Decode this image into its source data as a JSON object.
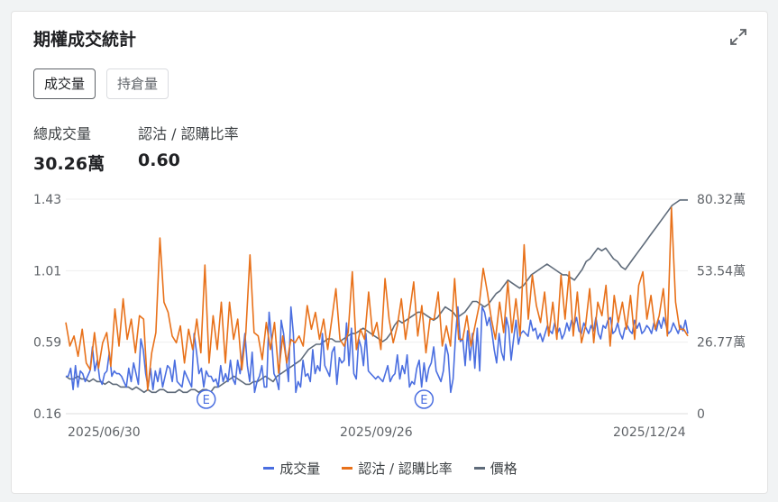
{
  "card": {
    "title": "期權成交統計",
    "tabs": [
      {
        "label": "成交量",
        "active": true
      },
      {
        "label": "持倉量",
        "active": false
      }
    ],
    "stats": [
      {
        "label": "總成交量",
        "value": "30.26萬"
      },
      {
        "label": "認沽 / 認購比率",
        "value": "0.60"
      }
    ],
    "expand_icon": "expand-icon"
  },
  "chart_data": {
    "type": "line",
    "x_tick_labels": [
      "2025/06/30",
      "2025/09/26",
      "2025/12/24"
    ],
    "left_axis": {
      "ticks": [
        "1.43",
        "1.01",
        "0.59",
        "0.16"
      ],
      "range": [
        0.16,
        1.43
      ]
    },
    "right_axis": {
      "ticks": [
        "80.32萬",
        "53.54萬",
        "26.77萬",
        "0"
      ],
      "range": [
        0,
        80.32
      ]
    },
    "markers": [
      {
        "label": "E",
        "x_index": 58
      },
      {
        "label": "E",
        "x_index": 148
      }
    ],
    "series": [
      {
        "name": "成交量",
        "axis": "right",
        "color": "#4a6ee0",
        "values": [
          14,
          14,
          17,
          9,
          18,
          10,
          16,
          15,
          12,
          14,
          16,
          25,
          16,
          20,
          13,
          11,
          15,
          16,
          23,
          14,
          16,
          15,
          15,
          14,
          12,
          10,
          17,
          12,
          19,
          15,
          11,
          28,
          24,
          15,
          10,
          17,
          9,
          16,
          12,
          17,
          10,
          14,
          18,
          17,
          12,
          20,
          12,
          11,
          10,
          16,
          14,
          12,
          10,
          30,
          23,
          15,
          17,
          10,
          16,
          14,
          14,
          12,
          13,
          10,
          18,
          12,
          15,
          12,
          20,
          13,
          11,
          20,
          15,
          22,
          30,
          18,
          12,
          23,
          8,
          12,
          14,
          18,
          10,
          10,
          38,
          28,
          15,
          13,
          9,
          35,
          30,
          21,
          12,
          40,
          30,
          8,
          12,
          10,
          20,
          14,
          15,
          12,
          24,
          15,
          18,
          16,
          30,
          18,
          16,
          14,
          23,
          25,
          11,
          21,
          19,
          20,
          34,
          18,
          32,
          15,
          13,
          28,
          25,
          18,
          30,
          16,
          15,
          14,
          13,
          14,
          13,
          12,
          15,
          18,
          12,
          14,
          15,
          22,
          13,
          18,
          15,
          22,
          10,
          12,
          11,
          17,
          20,
          10,
          19,
          12,
          17,
          19,
          25,
          16,
          14,
          12,
          16,
          26,
          22,
          8,
          13,
          29,
          40,
          27,
          28,
          18,
          31,
          20,
          30,
          17,
          32,
          16,
          40,
          38,
          33,
          36,
          31,
          24,
          19,
          30,
          23,
          20,
          36,
          32,
          20,
          28,
          35,
          26,
          30,
          31,
          30,
          29,
          35,
          31,
          32,
          28,
          30,
          27,
          30,
          33,
          31,
          30,
          34,
          30,
          32,
          28,
          30,
          34,
          31,
          35,
          33,
          36,
          31,
          30,
          34,
          32,
          30,
          33,
          31,
          36,
          30,
          28,
          33,
          32,
          35,
          36,
          30,
          31,
          34,
          30,
          28,
          32,
          33,
          31,
          30,
          35,
          32,
          34,
          30,
          31,
          33,
          32,
          30,
          34,
          31,
          35,
          32,
          36,
          33,
          30,
          31,
          34,
          32,
          30,
          33,
          31,
          35,
          30
        ]
      },
      {
        "name": "認沽 / 認購比率",
        "axis": "left",
        "color": "#e8711a",
        "values": [
          0.7,
          0.56,
          0.62,
          0.5,
          0.66,
          0.46,
          0.42,
          0.64,
          0.43,
          0.58,
          0.64,
          0.44,
          0.78,
          0.56,
          0.84,
          0.6,
          0.72,
          0.52,
          0.74,
          0.72,
          0.3,
          0.52,
          0.64,
          1.2,
          0.82,
          0.76,
          0.62,
          0.58,
          0.68,
          0.46,
          0.66,
          0.54,
          0.72,
          0.52,
          1.04,
          0.46,
          0.74,
          0.54,
          0.82,
          0.46,
          0.82,
          0.6,
          0.72,
          0.42,
          0.64,
          1.1,
          0.64,
          0.62,
          0.48,
          0.7,
          0.54,
          0.7,
          0.4,
          0.62,
          0.46,
          0.6,
          0.58,
          0.62,
          0.56,
          0.8,
          0.66,
          0.76,
          0.6,
          0.72,
          0.54,
          0.72,
          0.9,
          0.6,
          0.56,
          0.64,
          1.0,
          0.54,
          0.66,
          0.6,
          0.88,
          0.62,
          0.7,
          0.54,
          0.96,
          0.72,
          0.58,
          0.68,
          0.84,
          0.6,
          0.76,
          0.94,
          0.62,
          0.8,
          0.52,
          0.72,
          0.72,
          0.88,
          0.56,
          0.68,
          0.56,
          0.96,
          0.6,
          0.6,
          0.74,
          0.56,
          0.68,
          0.8,
          1.02,
          0.88,
          0.72,
          0.6,
          0.82,
          0.64,
          0.94,
          0.64,
          0.84,
          0.62,
          1.16,
          0.72,
          0.98,
          0.8,
          0.7,
          0.88,
          0.62,
          0.82,
          0.6,
          0.98,
          0.72,
          1.0,
          0.62,
          0.88,
          0.58,
          0.68,
          0.9,
          0.58,
          0.82,
          0.74,
          0.92,
          0.56,
          0.86,
          0.7,
          0.82,
          0.66,
          0.86,
          0.6,
          0.92,
          1.0,
          0.72,
          0.86,
          0.66,
          0.74,
          0.9,
          0.62,
          1.38,
          0.82,
          0.66,
          0.66,
          0.62
        ]
      },
      {
        "name": "價格",
        "axis": "right",
        "color": "#5f6b7a",
        "values": [
          14,
          13,
          13,
          14,
          13,
          13,
          12,
          13,
          12,
          12,
          11,
          12,
          11,
          11,
          10,
          10,
          10,
          9,
          10,
          9,
          8,
          9,
          8,
          8,
          9,
          9,
          8,
          8,
          8,
          9,
          8,
          8,
          9,
          9,
          8,
          9,
          9,
          8,
          10,
          10,
          11,
          12,
          13,
          14,
          13,
          12,
          11,
          11,
          12,
          12,
          13,
          14,
          13,
          12,
          14,
          15,
          16,
          17,
          18,
          19,
          20,
          22,
          24,
          25,
          26,
          26,
          27,
          28,
          28,
          27,
          27,
          28,
          29,
          30,
          30,
          31,
          32,
          31,
          30,
          29,
          28,
          27,
          28,
          30,
          33,
          35,
          34,
          35,
          36,
          37,
          38,
          38,
          37,
          36,
          35,
          36,
          38,
          40,
          39,
          38,
          36,
          37,
          38,
          40,
          42,
          42,
          41,
          40,
          41,
          43,
          45,
          46,
          48,
          50,
          49,
          48,
          47,
          48,
          50,
          52,
          53,
          54,
          55,
          56,
          55,
          54,
          53,
          52,
          52,
          51,
          50,
          52,
          54,
          57,
          58,
          60,
          62,
          61,
          62,
          60,
          58,
          57,
          55,
          54,
          56,
          58,
          60,
          62,
          64,
          66,
          68,
          70,
          72,
          74,
          76,
          78,
          79,
          80,
          80,
          80
        ]
      }
    ]
  }
}
